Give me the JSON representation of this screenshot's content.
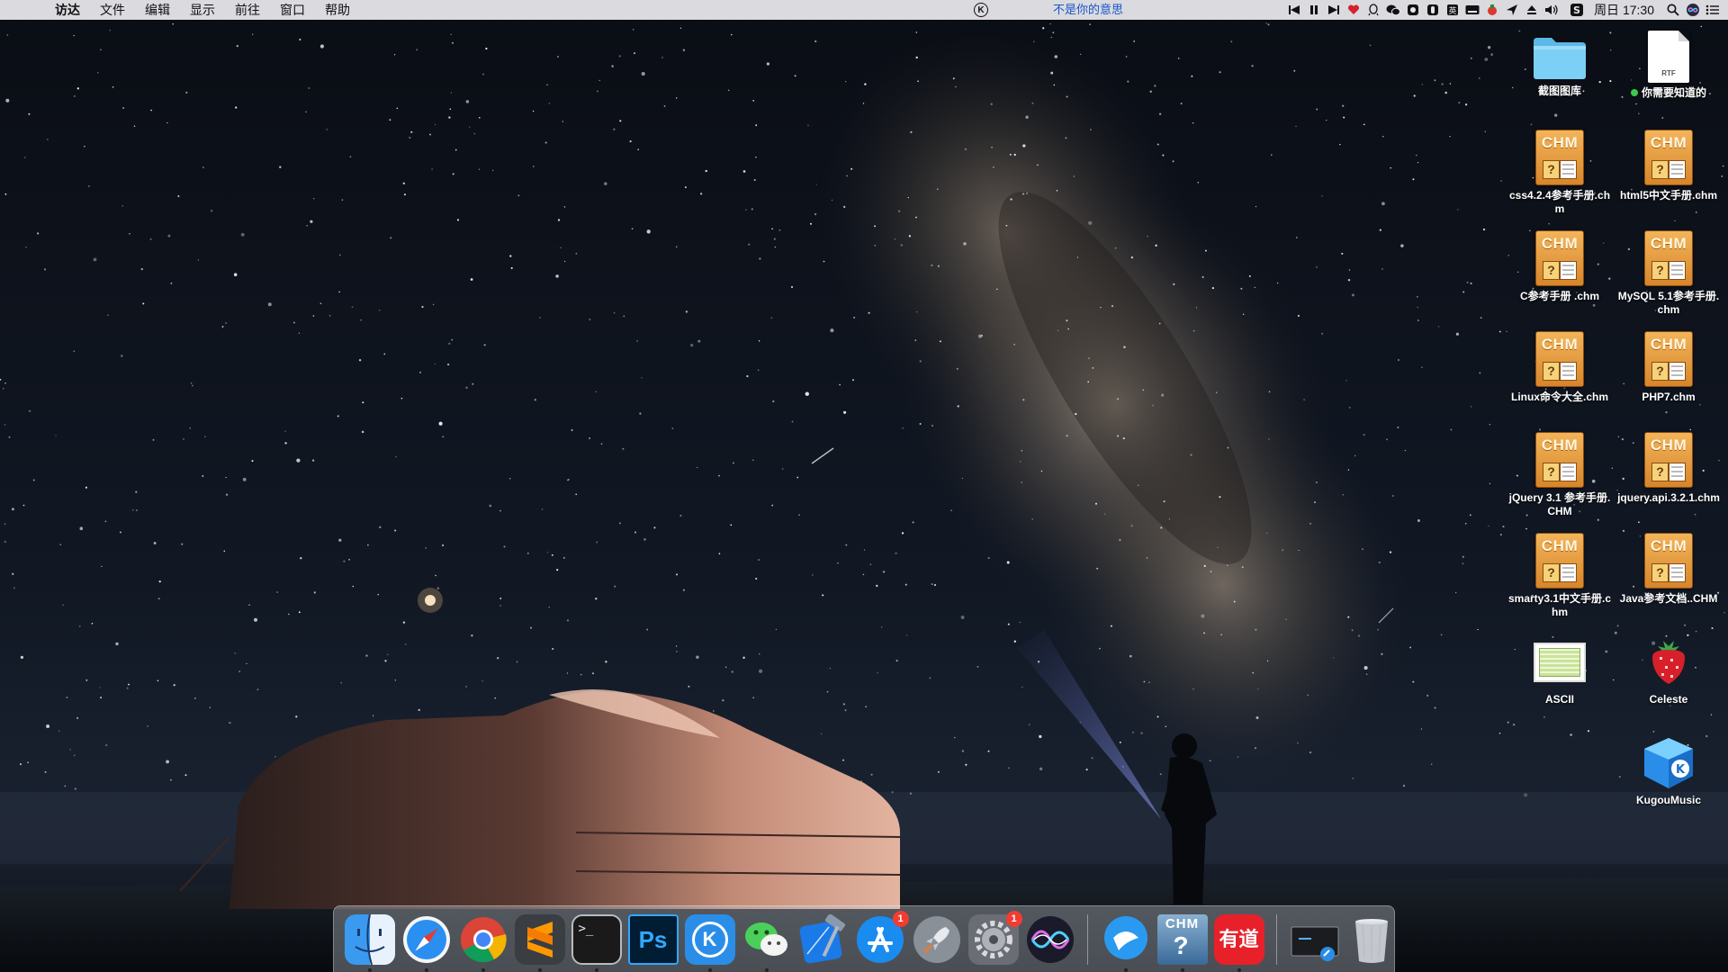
{
  "menubar": {
    "app_name": "访达",
    "menus": [
      "文件",
      "编辑",
      "显示",
      "前往",
      "窗口",
      "帮助"
    ],
    "now_playing": "不是你的意思",
    "clock": "周日 17:30",
    "status_icons": [
      "kugou-status-icon",
      "previous-track-icon",
      "pause-icon",
      "next-track-icon",
      "heart-icon",
      "qq-icon",
      "wechat-icon",
      "app-status-icon-1",
      "app-status-icon-2",
      "input-method-icon",
      "keyboard-icon",
      "cleaner-icon",
      "send-icon",
      "eject-icon",
      "volume-icon",
      "sync-icon",
      "search-icon",
      "siri-icon",
      "notification-list-icon"
    ]
  },
  "desktop": {
    "icons": [
      {
        "label": "截图图库",
        "kind": "folder"
      },
      {
        "label": "你需要知道的",
        "kind": "rtf",
        "file_type": "RTF"
      },
      {
        "label": "css4.2.4参考手册.chm",
        "kind": "chm"
      },
      {
        "label": "html5中文手册.chm",
        "kind": "chm"
      },
      {
        "label": "C参考手册 .chm",
        "kind": "chm"
      },
      {
        "label": "MySQL 5.1参考手册.chm",
        "kind": "chm"
      },
      {
        "label": "Linux命令大全.chm",
        "kind": "chm"
      },
      {
        "label": "PHP7.chm",
        "kind": "chm"
      },
      {
        "label": "jQuery 3.1 参考手册.CHM",
        "kind": "chm"
      },
      {
        "label": "jquery.api.3.2.1.chm",
        "kind": "chm"
      },
      {
        "label": "smarty3.1中文手册.chm",
        "kind": "chm"
      },
      {
        "label": "Java参考文档..CHM",
        "kind": "chm"
      },
      {
        "label": "ASCII",
        "kind": "spreadsheet"
      },
      {
        "label": "Celeste",
        "kind": "app"
      },
      {
        "label": "KugouMusic",
        "kind": "app"
      }
    ],
    "chm_badge_text": "CHM"
  },
  "dock": {
    "apps": [
      {
        "name": "Finder",
        "running": true
      },
      {
        "name": "Safari",
        "running": true
      },
      {
        "name": "Google Chrome",
        "running": true
      },
      {
        "name": "Sublime Text",
        "running": true
      },
      {
        "name": "Terminal",
        "running": true,
        "glyph": ">_"
      },
      {
        "name": "Photoshop",
        "running": false,
        "glyph": "Ps"
      },
      {
        "name": "KugouMusic",
        "running": true,
        "glyph": "K"
      },
      {
        "name": "WeChat",
        "running": true
      },
      {
        "name": "Xcode",
        "running": false
      },
      {
        "name": "App Store",
        "running": false,
        "badge": "1"
      },
      {
        "name": "Launchpad",
        "running": false
      },
      {
        "name": "System Preferences",
        "running": false,
        "badge": "1"
      },
      {
        "name": "Siri",
        "running": false
      },
      {
        "name": "QQ Browser",
        "running": true
      },
      {
        "name": "CHM Reader",
        "running": true,
        "glyph": "CHM"
      },
      {
        "name": "Youdao Dictionary",
        "running": true,
        "glyph": "有道"
      },
      {
        "name": "Screenshot",
        "running": false
      },
      {
        "name": "Trash",
        "running": false
      }
    ]
  },
  "colors": {
    "menubar_bg": "#e8e8ec",
    "now_playing": "#1a56c8",
    "chm_orange": "#e59a3c",
    "badge_red": "#f23c32"
  }
}
